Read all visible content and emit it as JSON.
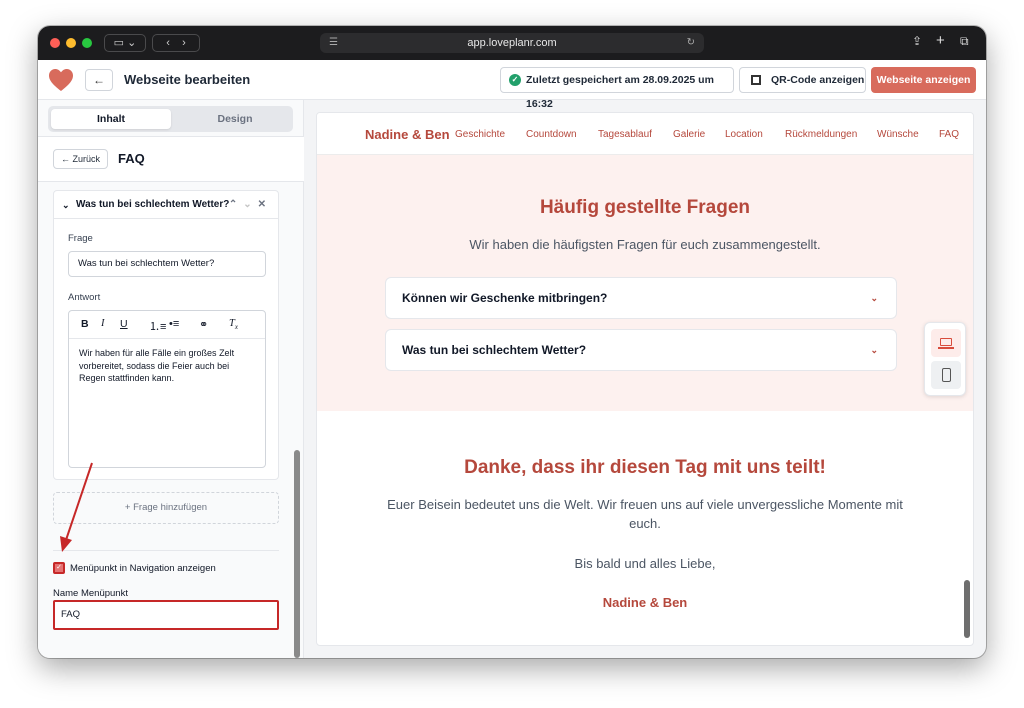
{
  "browser": {
    "url": "app.loveplanr.com"
  },
  "header": {
    "title": "Webseite bearbeiten",
    "back_label": "←",
    "saved_status": "Zuletzt gespeichert am 28.09.2025 um 16:32",
    "qr_label": "QR-Code anzeigen",
    "view_label": "Webseite anzeigen",
    "brand_color": "#d86b5c"
  },
  "sidebar": {
    "tabs": [
      {
        "label": "Inhalt",
        "active": true
      },
      {
        "label": "Design",
        "active": false
      }
    ],
    "back_label": "← Zurück",
    "section_title": "FAQ",
    "faq_item": {
      "header": "Was tun bei schlechtem Wetter?",
      "question_label": "Frage",
      "question_value": "Was tun bei schlechtem Wetter?",
      "answer_label": "Antwort",
      "answer_value": "Wir haben für alle Fälle ein großes Zelt vorbereitet, sodass die Feier auch bei Regen stattfinden kann.",
      "toolbar": [
        "B",
        "I",
        "U",
        "ordered-list-icon",
        "bullet-list-icon",
        "link-icon",
        "clear-format-icon"
      ]
    },
    "add_question_label": "+ Frage hinzufügen",
    "menu_checkbox_label": "Menüpunkt in Navigation anzeigen",
    "menu_checkbox_checked": true,
    "menu_name_label": "Name Menüpunkt",
    "menu_name_value": "FAQ"
  },
  "preview": {
    "brand": "Nadine & Ben",
    "nav": [
      "Geschichte",
      "Countdown",
      "Tagesablauf",
      "Galerie",
      "Location",
      "Rückmeldungen",
      "Wünsche",
      "FAQ"
    ],
    "faq_title": "Häufig gestellte Fragen",
    "faq_subtitle": "Wir haben die häufigsten Fragen für euch zusammengestellt.",
    "faq_items": [
      "Können wir Geschenke mitbringen?",
      "Was tun bei schlechtem Wetter?"
    ],
    "thanks_title": "Danke, dass ihr diesen Tag mit uns teilt!",
    "thanks_text": "Euer Beisein bedeutet uns die Welt. Wir freuen uns auf viele unvergessliche Momente mit euch.",
    "closing": "Bis bald und alles Liebe,",
    "signature": "Nadine & Ben",
    "accent_color": "#b5483c",
    "section_bg": "#fdf1ef"
  },
  "device_toggle": {
    "active": "laptop-icon",
    "options": [
      "laptop-icon",
      "phone-icon"
    ]
  }
}
